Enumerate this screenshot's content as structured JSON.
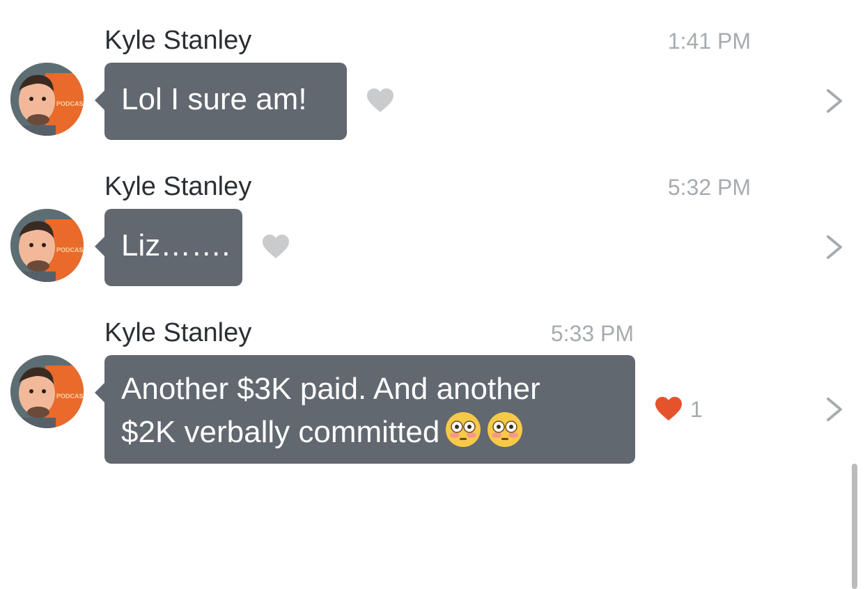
{
  "messages": [
    {
      "sender": "Kyle Stanley",
      "time": "1:41 PM",
      "text": "Lol I sure am!",
      "liked": false,
      "like_count": ""
    },
    {
      "sender": "Kyle Stanley",
      "time": "5:32 PM",
      "text": "Liz…….",
      "liked": false,
      "like_count": ""
    },
    {
      "sender": "Kyle Stanley",
      "time": "5:33 PM",
      "text_line1": "Another $3K paid. And another",
      "text_line2": "$2K verbally committed",
      "emoji": [
        "flushed-face-emoji",
        "flushed-face-emoji"
      ],
      "liked": true,
      "like_count": "1"
    }
  ],
  "colors": {
    "bubble": "#626870",
    "heart_inactive": "#c9cbcd",
    "heart_active": "#e5532d",
    "timestamp": "#a7abaf",
    "sender": "#2b2f33",
    "chevron": "#a7abaf"
  },
  "icons": {
    "chevron": "chevron-right-icon",
    "heart": "heart-icon",
    "avatar": "avatar"
  }
}
